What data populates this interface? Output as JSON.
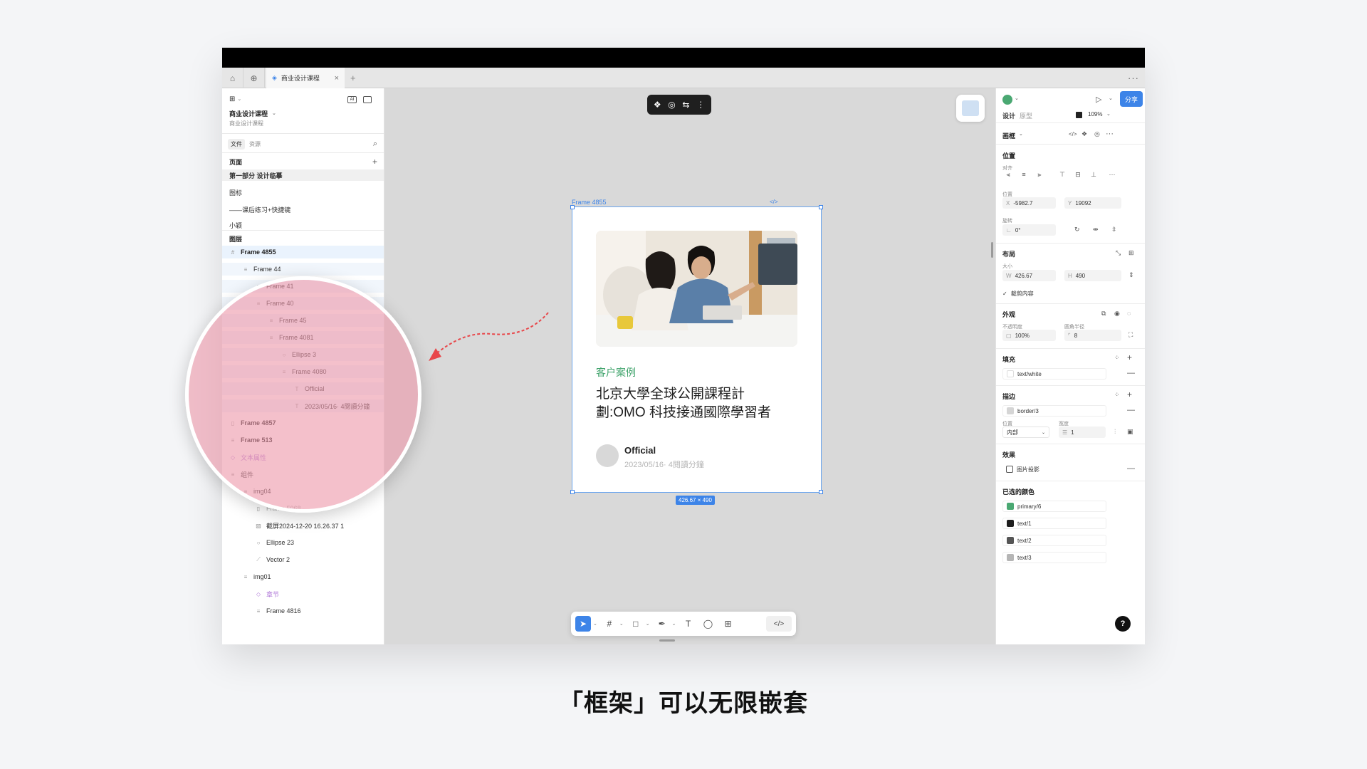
{
  "tabbar": {
    "active_tab": "商业设计课程"
  },
  "left_panel": {
    "project_title": "商业设计课程",
    "project_subtitle": "商业设计课程",
    "ai_badge": "AI",
    "tabs": [
      "文件",
      "资源"
    ],
    "pages_header": "页面",
    "pages": [
      "第一部分 设计临摹",
      "图标",
      "——课后练习+快捷键",
      "小颖"
    ],
    "layers_header": "图层",
    "layers": [
      {
        "name": "Frame 4855",
        "indent": 0,
        "icon": "#",
        "bold": true
      },
      {
        "name": "Frame 44",
        "indent": 1,
        "icon": "≡"
      },
      {
        "name": "Frame 41",
        "indent": 2,
        "icon": "≡"
      },
      {
        "name": "Frame 40",
        "indent": 2,
        "icon": "≡"
      },
      {
        "name": "Frame 45",
        "indent": 3,
        "icon": "≡"
      },
      {
        "name": "Frame 4081",
        "indent": 3,
        "icon": "≡"
      },
      {
        "name": "Ellipse 3",
        "indent": 4,
        "icon": "○"
      },
      {
        "name": "Frame 4080",
        "indent": 4,
        "icon": "≡"
      },
      {
        "name": "Official",
        "indent": 5,
        "icon": "T"
      },
      {
        "name": "2023/05/16· 4閱讀分鐘",
        "indent": 5,
        "icon": "T"
      },
      {
        "name": "Frame 4857",
        "indent": 0,
        "icon": "▯",
        "bold": true
      },
      {
        "name": "Frame 513",
        "indent": 0,
        "icon": "≡",
        "bold": true
      },
      {
        "name": "文本属性",
        "indent": 0,
        "icon": "◇",
        "purple": true
      },
      {
        "name": "组件",
        "indent": 0,
        "icon": "≡"
      },
      {
        "name": "img04",
        "indent": 1,
        "icon": "≡"
      },
      {
        "name": "Frame 5068",
        "indent": 2,
        "icon": "▯",
        "muted": true
      },
      {
        "name": "截屏2024-12-20 16.26.37 1",
        "indent": 2,
        "icon": "▨"
      },
      {
        "name": "Ellipse 23",
        "indent": 2,
        "icon": "○"
      },
      {
        "name": "Vector 2",
        "indent": 2,
        "icon": "⟋"
      },
      {
        "name": "img01",
        "indent": 1,
        "icon": "≡"
      },
      {
        "name": "章节",
        "indent": 2,
        "icon": "◇",
        "purple": true
      },
      {
        "name": "Frame 4816",
        "indent": 2,
        "icon": "≡"
      }
    ]
  },
  "canvas": {
    "frame_label": "Frame 4855",
    "size_badge": "426.67 × 490",
    "card": {
      "category": "客户案例",
      "headline_line1": "北京大學全球公開課程計",
      "headline_line2": "劃:OMO 科技接通國際學習者",
      "author": "Official",
      "date": "2023/05/16· 4閱讀分鐘"
    }
  },
  "right_panel": {
    "share_label": "分享",
    "tabs": [
      "设计",
      "原型"
    ],
    "zoom": "109%",
    "element_type": "画框",
    "position_header": "位置",
    "align_label": "对齐",
    "pos_label": "位置",
    "x_value": "-5982.7",
    "y_value": "19092",
    "rotate_label": "旋转",
    "rotation": "0°",
    "layout_header": "布局",
    "size_label": "大小",
    "w_value": "426.67",
    "h_value": "490",
    "clip_content": "裁剪内容",
    "appearance_header": "外观",
    "opacity_label": "不透明度",
    "radius_label": "圆角半径",
    "opacity_value": "100%",
    "radius_value": "8",
    "fill_header": "填充",
    "fill_value": "text/white",
    "stroke_header": "描边",
    "stroke_value": "border/3",
    "stroke_pos_label": "位置",
    "stroke_width_label": "宽度",
    "stroke_pos_value": "内部",
    "stroke_width_value": "1",
    "effects_header": "效果",
    "effect_value": "图片投影",
    "selected_colors_header": "已选的颜色",
    "selected_colors": [
      {
        "name": "primary/6",
        "color": "#4aa872"
      },
      {
        "name": "text/1",
        "color": "#1d1d1d"
      },
      {
        "name": "text/2",
        "color": "#555555"
      },
      {
        "name": "text/3",
        "color": "#b5b5b5"
      }
    ]
  },
  "caption": "「框架」可以无限嵌套"
}
